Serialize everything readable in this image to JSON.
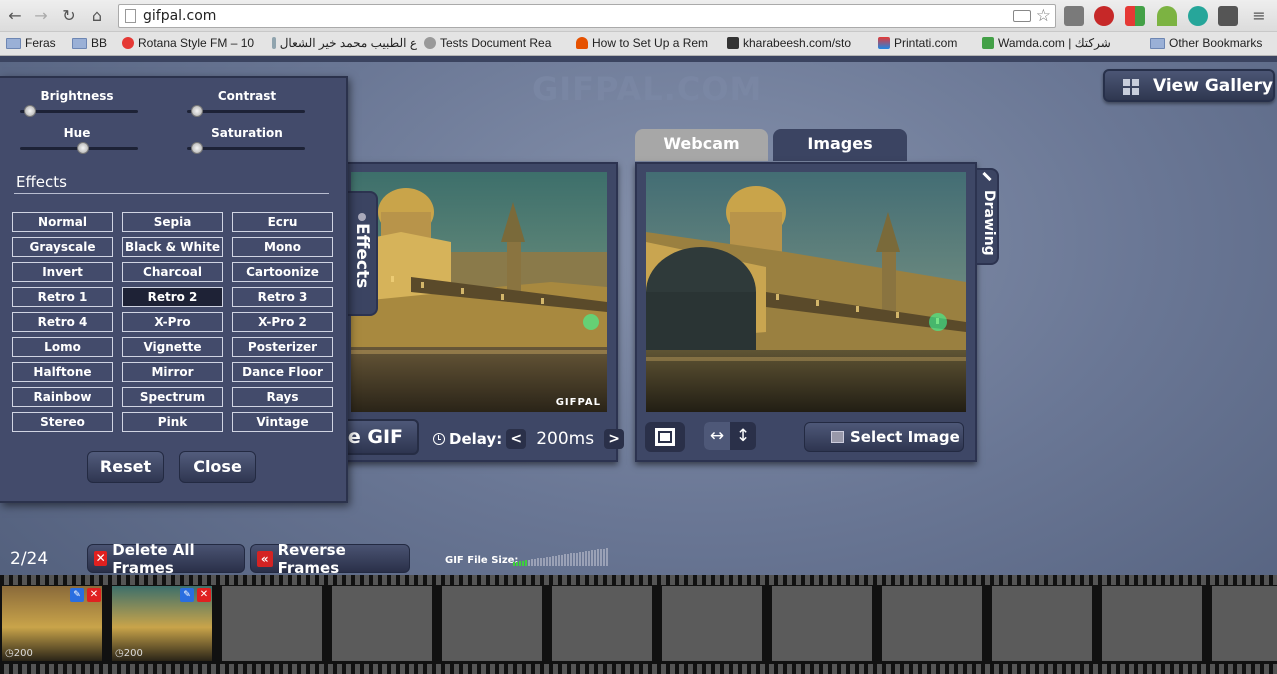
{
  "browser": {
    "url": "gifpal.com",
    "bookmarks": [
      {
        "label": "Feras",
        "type": "folder"
      },
      {
        "label": "BB",
        "type": "folder"
      },
      {
        "label": "Rotana Style FM – 10",
        "type": "site"
      },
      {
        "label": "ع الطبيب محمد خير الشعال",
        "type": "site"
      },
      {
        "label": "Tests Document Rea",
        "type": "site"
      },
      {
        "label": "How to Set Up a Rem",
        "type": "site"
      },
      {
        "label": "kharabeesh.com/sto",
        "type": "site"
      },
      {
        "label": "Printati.com",
        "type": "site"
      },
      {
        "label": "Wamda.com | شركتك",
        "type": "site"
      },
      {
        "label": "Other Bookmarks",
        "type": "folder"
      }
    ]
  },
  "app": {
    "logo": "GIFPAL.COM",
    "view_gallery": "View Gallery",
    "tabs": {
      "webcam": "Webcam",
      "images": "Images"
    },
    "side_tabs": {
      "effects": "Effects",
      "drawing": "Drawing"
    },
    "save_gif": "ve GIF",
    "delay_label": "Delay:",
    "delay_value": "200ms",
    "delay_prev": "<",
    "delay_next": ">",
    "watermark": "GIFPAL",
    "select_image": "Select Image",
    "frame_count": "2/24",
    "delete_all": "Delete All Frames",
    "reverse_frames": "Reverse Frames",
    "gif_size_label": "GIF File Size:",
    "gif_size_level": 0.15
  },
  "effects_dialog": {
    "sliders": [
      {
        "label": "Brightness",
        "value": 0.0
      },
      {
        "label": "Contrast",
        "value": 0.0
      },
      {
        "label": "Hue",
        "value": 0.5
      },
      {
        "label": "Saturation",
        "value": 0.0
      }
    ],
    "heading": "Effects",
    "effects": [
      "Normal",
      "Sepia",
      "Ecru",
      "Grayscale",
      "Black & White",
      "Mono",
      "Invert",
      "Charcoal",
      "Cartoonize",
      "Retro 1",
      "Retro 2",
      "Retro 3",
      "Retro 4",
      "X-Pro",
      "X-Pro 2",
      "Lomo",
      "Vignette",
      "Posterizer",
      "Halftone",
      "Mirror",
      "Dance Floor",
      "Rainbow",
      "Spectrum",
      "Rays",
      "Stereo",
      "Pink",
      "Vintage"
    ],
    "selected": "Retro 2",
    "reset": "Reset",
    "close": "Close"
  },
  "frames": [
    {
      "delay": "200",
      "filled": true
    },
    {
      "delay": "200",
      "filled": true
    }
  ],
  "colors": {
    "accent": "#3b4462",
    "delete": "#e02020",
    "edit": "#2a6ee0"
  }
}
